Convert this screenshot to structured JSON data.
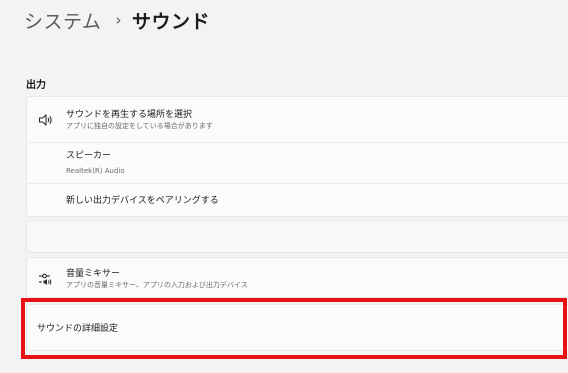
{
  "breadcrumb": {
    "parent": "システム",
    "separator": "›",
    "current": "サウンド"
  },
  "output": {
    "header": "出力",
    "choose_device": {
      "title": "サウンドを再生する場所を選択",
      "subtitle": "アプリに独自の設定をしている場合があります",
      "icon": "speaker-icon"
    },
    "speaker": {
      "title": "スピーカー",
      "subtitle": "Realtek(R) Audio"
    },
    "pair": {
      "title": "新しい出力デバイスをペアリングする"
    }
  },
  "mixer": {
    "title": "音量ミキサー",
    "subtitle": "アプリの音量ミキサー、アプリの入力および出力デバイス",
    "icon": "volume-mixer-icon"
  },
  "advanced": {
    "label": "サウンドの詳細設定"
  },
  "colors": {
    "highlight": "#e81216",
    "background": "#f3f3f3",
    "card": "#fbfbfb"
  }
}
